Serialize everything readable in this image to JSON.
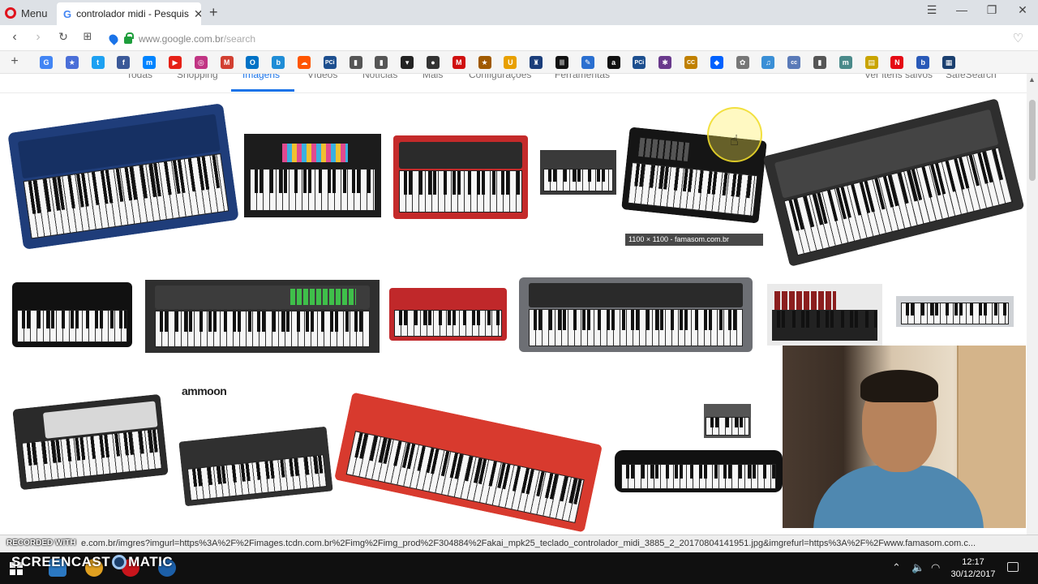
{
  "browser": {
    "menu_label": "Menu",
    "tab_title": "controlador midi - Pesquis",
    "favicon": "G",
    "url_domain": "www.google.com.br",
    "url_path": "/search"
  },
  "google_nav": {
    "items": [
      "Todas",
      "Shopping",
      "Imagens",
      "Vídeos",
      "Notícias",
      "Mais",
      "Configurações",
      "Ferramentas"
    ],
    "right_items": [
      "Ver itens salvos",
      "SafeSearch"
    ],
    "active": "Imagens"
  },
  "results": {
    "hover_caption": "1100 × 1100 - famasom.com.br",
    "brand_label": "ammoon"
  },
  "bookmarks": [
    {
      "icon": "google-icon",
      "color": "#4285f4",
      "glyph": "G"
    },
    {
      "icon": "app-icon",
      "color": "#4a6fd8",
      "glyph": "★"
    },
    {
      "icon": "twitter-icon",
      "color": "#1da1f2",
      "glyph": "t"
    },
    {
      "icon": "facebook-icon",
      "color": "#3b5998",
      "glyph": "f"
    },
    {
      "icon": "messenger-icon",
      "color": "#0084ff",
      "glyph": "m"
    },
    {
      "icon": "youtube-icon",
      "color": "#e62117",
      "glyph": "▶"
    },
    {
      "icon": "instagram-icon",
      "color": "#c13584",
      "glyph": "◎"
    },
    {
      "icon": "gmail-icon",
      "color": "#d23f31",
      "glyph": "M"
    },
    {
      "icon": "outlook-icon",
      "color": "#0072c6",
      "glyph": "O"
    },
    {
      "icon": "bing-icon",
      "color": "#1f8dd6",
      "glyph": "b"
    },
    {
      "icon": "soundcloud-icon",
      "color": "#ff5500",
      "glyph": "☁"
    },
    {
      "icon": "pci-icon",
      "color": "#1d4f8f",
      "glyph": "PCi"
    },
    {
      "icon": "document-icon",
      "color": "#555555",
      "glyph": "▮"
    },
    {
      "icon": "document-icon",
      "color": "#555555",
      "glyph": "▮"
    },
    {
      "icon": "cart-icon",
      "color": "#222222",
      "glyph": "▾"
    },
    {
      "icon": "pin-icon",
      "color": "#333333",
      "glyph": "●"
    },
    {
      "icon": "red-circle-icon",
      "color": "#d01010",
      "glyph": "M"
    },
    {
      "icon": "star-icon",
      "color": "#a05a00",
      "glyph": "★"
    },
    {
      "icon": "app-icon",
      "color": "#e8a000",
      "glyph": "U"
    },
    {
      "icon": "app-icon",
      "color": "#1a3d7a",
      "glyph": "♜"
    },
    {
      "icon": "piano-icon",
      "color": "#111111",
      "glyph": "|||"
    },
    {
      "icon": "pen-icon",
      "color": "#2a6fd0",
      "glyph": "✎"
    },
    {
      "icon": "amazon-icon",
      "color": "#111111",
      "glyph": "a"
    },
    {
      "icon": "pci-icon",
      "color": "#1d4f8f",
      "glyph": "PCi"
    },
    {
      "icon": "yamaha-icon",
      "color": "#6a3a8c",
      "glyph": "✱"
    },
    {
      "icon": "cc-icon",
      "color": "#c08000",
      "glyph": "CC"
    },
    {
      "icon": "dropbox-icon",
      "color": "#0061fe",
      "glyph": "◆"
    },
    {
      "icon": "app-icon",
      "color": "#777777",
      "glyph": "✿"
    },
    {
      "icon": "app-icon",
      "color": "#3a8fd6",
      "glyph": "♫"
    },
    {
      "icon": "app-icon",
      "color": "#5a7ab8",
      "glyph": "cc"
    },
    {
      "icon": "document-icon",
      "color": "#555555",
      "glyph": "▮"
    },
    {
      "icon": "app-icon",
      "color": "#4a8a8a",
      "glyph": "m"
    },
    {
      "icon": "app-icon",
      "color": "#c9a400",
      "glyph": "▤"
    },
    {
      "icon": "netflix-icon",
      "color": "#e50914",
      "glyph": "N"
    },
    {
      "icon": "app-icon",
      "color": "#2a5ab8",
      "glyph": "b"
    },
    {
      "icon": "app-icon",
      "color": "#1a3f6f",
      "glyph": "▦"
    }
  ],
  "status_url": "https://www.google.com.br/imgres?imgurl=https%3A%2F%2Fimages.tcdn.com.br%2Fimg%2Fimg_prod%2F304884%2Fakai_mpk25_teclado_controlador_midi_3885_2_20170804141951.jpg&imgrefurl=https%3A%2F%2Fwww.famasom.com.c...",
  "status_url_visible": "e.com.br/imgres?imgurl=https%3A%2F%2Fimages.tcdn.com.br%2Fimg%2Fimg_prod%2F304884%2Fakai_mpk25_teclado_controlador_midi_3885_2_20170804141951.jpg&imgrefurl=https%3A%2F%2Fwww.famasom.com.c...",
  "watermark": {
    "recorded_with": "RECORDED WITH",
    "brand_left": "SCREENCAST",
    "brand_right": "MATIC"
  },
  "taskbar": {
    "time": "12:17",
    "date": "30/12/2017"
  }
}
